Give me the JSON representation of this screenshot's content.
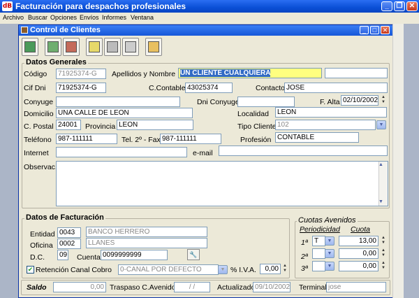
{
  "app": {
    "icon_text": "dB",
    "title": "Facturación para despachos profesionales"
  },
  "menu": [
    "Archivo",
    "Buscar",
    "Opciones",
    "Envíos",
    "Informes",
    "Ventana"
  ],
  "child": {
    "title": "Control de Clientes"
  },
  "general": {
    "title": "Datos Generales",
    "codigo_label": "Código",
    "codigo": "71925374-G",
    "apellidos_label": "Apellidos y Nombre",
    "apellidos": "UN CLIENTE CUALQUIERA",
    "cif_label": "Cif Dni",
    "cif": "71925374-G",
    "ccontable_label": "C.Contable",
    "ccontable": "43025374",
    "contacto_label": "Contacto",
    "contacto": "JOSE",
    "conyuge_label": "Conyuge",
    "conyuge": "",
    "dniconyuge_label": "Dni Conyuge",
    "dniconyuge": "",
    "falta_label": "F. Alta",
    "falta": "02/10/2002",
    "domicilio_label": "Domicilio",
    "domicilio": "UNA CALLE DE LEON",
    "localidad_label": "Localidad",
    "localidad": "LEON",
    "cpostal_label": "C. Postal",
    "cpostal": "24001",
    "provincia_label": "Provincia",
    "provincia": "LEON",
    "tipocliente_label": "Tipo Cliente",
    "tipocliente": "102",
    "telefono_label": "Teléfono",
    "telefono": "987-111111",
    "fax_label": "Tel. 2º - Fax",
    "fax": "987-111111",
    "profesion_label": "Profesión",
    "profesion": "CONTABLE",
    "internet_label": "Internet",
    "internet": "",
    "email_label": "e-mail",
    "email": "",
    "observac_label": "Observac.",
    "observac": ""
  },
  "facturacion": {
    "title": "Datos de Facturación",
    "entidad_label": "Entidad",
    "entidad": "0043",
    "entidad_name": "BANCO HERRERO",
    "oficina_label": "Oficina",
    "oficina": "0002",
    "oficina_name": "LLANES",
    "dc_label": "D.C.",
    "dc": "09",
    "cuenta_label": "Cuenta",
    "cuenta": "0099999999",
    "retencion_label": "Retención",
    "retencion_checked": true,
    "canal_label": "Canal Cobro",
    "canal": "0-CANAL POR DEFECTO",
    "iva_label": "% I.V.A.",
    "iva": "0,00"
  },
  "cuotas": {
    "title": "Cuotas Avenidos",
    "periodicidad_label": "Periodicidad",
    "cuota_label": "Cuota",
    "rows": [
      {
        "label": "1ª",
        "periodicidad": "T",
        "cuota": "13,00"
      },
      {
        "label": "2ª",
        "periodicidad": "",
        "cuota": "0,00"
      },
      {
        "label": "3ª",
        "periodicidad": "",
        "cuota": "0,00"
      }
    ]
  },
  "bottom": {
    "saldo_label": "Saldo",
    "saldo": "0,00",
    "traspaso_label": "Traspaso C.Avenidos",
    "traspaso": "/ /",
    "actualizado_label": "Actualizado",
    "actualizado": "09/10/2002",
    "terminal_label": "Terminal",
    "terminal": "jose"
  }
}
